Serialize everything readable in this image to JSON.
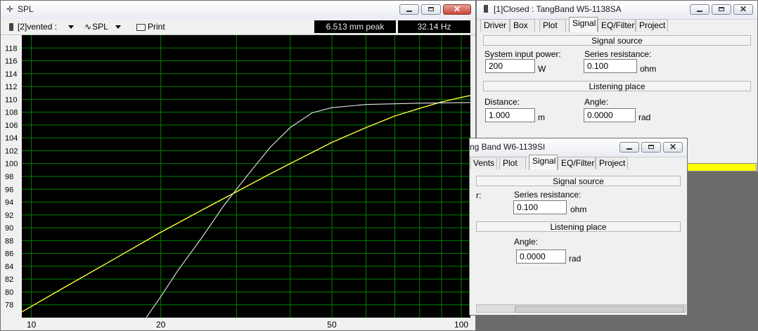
{
  "spl_window": {
    "title": "SPL",
    "toolbar": {
      "project_selector": "[2]vented :",
      "plot_selector": "SPL",
      "print_label": "Print",
      "excursion_readout": "6.513 mm peak",
      "frequency_readout": "32.14 Hz"
    }
  },
  "dialog_front": {
    "title": "[1]Closed : TangBand W5-1138SA",
    "tabs": [
      "Driver",
      "Box",
      "Plot",
      "Signal",
      "EQ/Filter",
      "Project"
    ],
    "active_tab": "Signal",
    "signal_source_header": "Signal source",
    "system_input_power_label": "System input power:",
    "system_input_power_value": "200",
    "system_input_power_unit": "W",
    "series_resistance_label": "Series resistance:",
    "series_resistance_value": "0.100",
    "series_resistance_unit": "ohm",
    "listening_place_header": "Listening place",
    "distance_label": "Distance:",
    "distance_value": "1.000",
    "distance_unit": "m",
    "angle_label": "Angle:",
    "angle_value": "0.0000",
    "angle_unit": "rad",
    "indicator_color": "#ffff00"
  },
  "dialog_back": {
    "title": "ng Band W6-1139SI",
    "tabs": [
      "Vents",
      "Plot",
      "Signal",
      "EQ/Filter",
      "Project"
    ],
    "active_tab": "Signal",
    "cut_label": "r:",
    "signal_source_header": "Signal source",
    "series_resistance_label": "Series resistance:",
    "series_resistance_value": "0.100",
    "series_resistance_unit": "ohm",
    "listening_place_header": "Listening place",
    "angle_label": "Angle:",
    "angle_value": "0.0000",
    "angle_unit": "rad"
  },
  "chart_data": {
    "type": "line",
    "xscale": "log",
    "xlim": [
      9.5,
      105
    ],
    "ylim": [
      76,
      120
    ],
    "x_ticks": [
      10,
      20,
      50,
      100
    ],
    "y_ticks": [
      78,
      80,
      82,
      84,
      86,
      88,
      90,
      92,
      94,
      96,
      98,
      100,
      102,
      104,
      106,
      108,
      110,
      112,
      114,
      116,
      118
    ],
    "grid": true,
    "colors": {
      "background": "#000000",
      "grid": "#008000",
      "series_vented": "#ffff33",
      "series_closed": "#e8e8e8"
    },
    "series": [
      {
        "color": "yellow",
        "x": [
          9.5,
          12,
          15,
          20,
          25,
          30,
          35,
          40,
          50,
          60,
          70,
          80,
          90,
          100,
          105
        ],
        "y": [
          76.9,
          80.8,
          84.5,
          89.3,
          92.8,
          95.6,
          98.0,
          100.0,
          103.3,
          105.6,
          107.4,
          108.6,
          109.6,
          110.3,
          110.6
        ]
      },
      {
        "color": "white",
        "x": [
          18.5,
          20,
          22,
          25,
          28,
          30,
          33,
          36,
          40,
          45,
          50,
          60,
          80,
          105
        ],
        "y": [
          76,
          79.3,
          83.5,
          88.6,
          93.4,
          96.0,
          99.5,
          102.6,
          105.6,
          107.9,
          108.7,
          109.2,
          109.4,
          109.5
        ]
      }
    ]
  }
}
